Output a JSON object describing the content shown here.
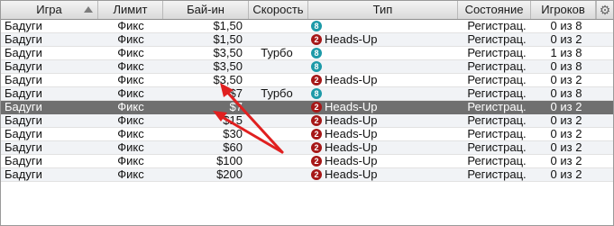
{
  "columns": {
    "game": "Игра",
    "limit": "Лимит",
    "buyin": "Бай-ин",
    "speed": "Скорость",
    "type": "Тип",
    "state": "Состояние",
    "players": "Игроков"
  },
  "icons": {
    "sort": "sort-ascending-icon",
    "settings": "gear-icon",
    "badge_8": "eight-game-badge-icon",
    "badge_2": "two-player-badge-icon"
  },
  "colors": {
    "selected_row": "#6f6f6f",
    "badge_teal": "#1d9aa8",
    "badge_red": "#a61717",
    "arrow": "#e02020"
  },
  "rows": [
    {
      "game": "Бадуги",
      "limit": "Фикс",
      "buyin": "$1,50",
      "speed": "",
      "badge": "8",
      "badge_color": "teal",
      "type": "",
      "state": "Регистрац.",
      "players": "0 из 8"
    },
    {
      "game": "Бадуги",
      "limit": "Фикс",
      "buyin": "$1,50",
      "speed": "",
      "badge": "2",
      "badge_color": "red",
      "type": "Heads-Up",
      "state": "Регистрац.",
      "players": "0 из 2"
    },
    {
      "game": "Бадуги",
      "limit": "Фикс",
      "buyin": "$3,50",
      "speed": "Турбо",
      "badge": "8",
      "badge_color": "teal",
      "type": "",
      "state": "Регистрац.",
      "players": "1 из 8"
    },
    {
      "game": "Бадуги",
      "limit": "Фикс",
      "buyin": "$3,50",
      "speed": "",
      "badge": "8",
      "badge_color": "teal",
      "type": "",
      "state": "Регистрац.",
      "players": "0 из 8"
    },
    {
      "game": "Бадуги",
      "limit": "Фикс",
      "buyin": "$3,50",
      "speed": "",
      "badge": "2",
      "badge_color": "red",
      "type": "Heads-Up",
      "state": "Регистрац.",
      "players": "0 из 2"
    },
    {
      "game": "Бадуги",
      "limit": "Фикс",
      "buyin": "$7",
      "speed": "Турбо",
      "badge": "8",
      "badge_color": "teal",
      "type": "",
      "state": "Регистрац.",
      "players": "0 из 8"
    },
    {
      "game": "Бадуги",
      "limit": "Фикс",
      "buyin": "$7",
      "speed": "",
      "badge": "2",
      "badge_color": "red",
      "type": "Heads-Up",
      "state": "Регистрац.",
      "players": "0 из 2",
      "selected": true
    },
    {
      "game": "Бадуги",
      "limit": "Фикс",
      "buyin": "$15",
      "speed": "",
      "badge": "2",
      "badge_color": "red",
      "type": "Heads-Up",
      "state": "Регистрац.",
      "players": "0 из 2"
    },
    {
      "game": "Бадуги",
      "limit": "Фикс",
      "buyin": "$30",
      "speed": "",
      "badge": "2",
      "badge_color": "red",
      "type": "Heads-Up",
      "state": "Регистрац.",
      "players": "0 из 2"
    },
    {
      "game": "Бадуги",
      "limit": "Фикс",
      "buyin": "$60",
      "speed": "",
      "badge": "2",
      "badge_color": "red",
      "type": "Heads-Up",
      "state": "Регистрац.",
      "players": "0 из 2"
    },
    {
      "game": "Бадуги",
      "limit": "Фикс",
      "buyin": "$100",
      "speed": "",
      "badge": "2",
      "badge_color": "red",
      "type": "Heads-Up",
      "state": "Регистрац.",
      "players": "0 из 2"
    },
    {
      "game": "Бадуги",
      "limit": "Фикс",
      "buyin": "$200",
      "speed": "",
      "badge": "2",
      "badge_color": "red",
      "type": "Heads-Up",
      "state": "Регистрац.",
      "players": "0 из 2"
    }
  ]
}
